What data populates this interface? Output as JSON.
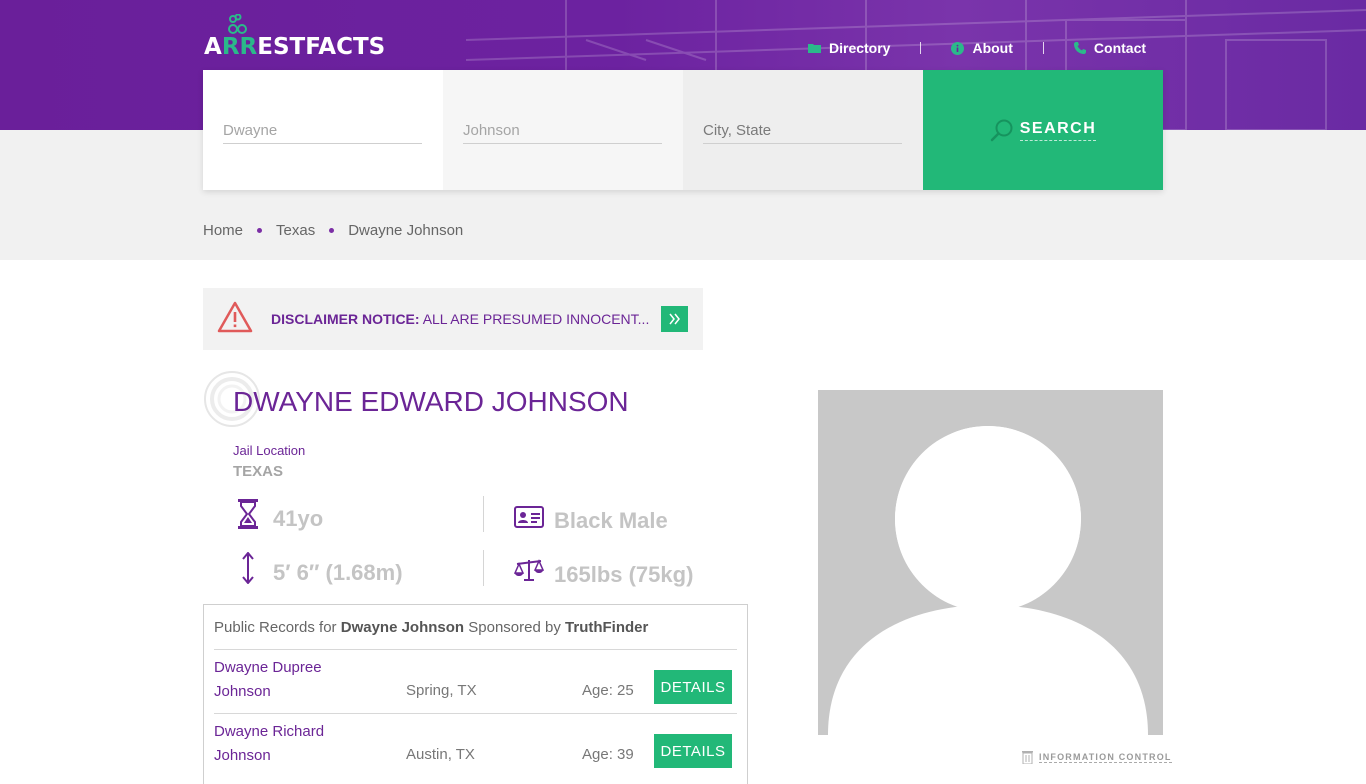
{
  "header": {
    "logo": {
      "part1": "A",
      "part2": "RR",
      "part3": "ESTFACTS"
    },
    "nav": [
      {
        "label": "Directory",
        "icon": "folder-icon"
      },
      {
        "label": "About",
        "icon": "info-icon"
      },
      {
        "label": "Contact",
        "icon": "phone-icon"
      }
    ]
  },
  "search": {
    "first_name_placeholder": "Dwayne",
    "last_name_placeholder": "Johnson",
    "location_placeholder": "City, State",
    "button_label": "SEARCH",
    "button_icon": "search-icon"
  },
  "breadcrumb": [
    "Home",
    "Texas",
    "Dwayne Johnson"
  ],
  "disclaimer": {
    "title": "DISCLAIMER NOTICE:",
    "text": "ALL ARE PRESUMED INNOCENT...",
    "icon": "warning-icon"
  },
  "person": {
    "name": "DWAYNE EDWARD JOHNSON",
    "jail_location_label": "Jail Location",
    "jail_location": "TEXAS",
    "age": "41yo",
    "race_gender": "Black Male",
    "height": "5′ 6″ (1.68m)",
    "weight": "165lbs (75kg)"
  },
  "records": {
    "prefix": "Public Records for",
    "name": "Dwayne Johnson",
    "middle": "Sponsored by",
    "sponsor": "TruthFinder",
    "rows": [
      {
        "name": "Dwayne Dupree Johnson",
        "location": "Spring, TX",
        "age": "Age: 25",
        "button": "DETAILS"
      },
      {
        "name": "Dwayne Richard Johnson",
        "location": "Austin, TX",
        "age": "Age: 39",
        "button": "DETAILS"
      }
    ]
  },
  "info_control": "INFORMATION CONTROL",
  "colors": {
    "purple": "#6b2596",
    "green": "#22b878",
    "grey_band": "#f1f1f1"
  }
}
